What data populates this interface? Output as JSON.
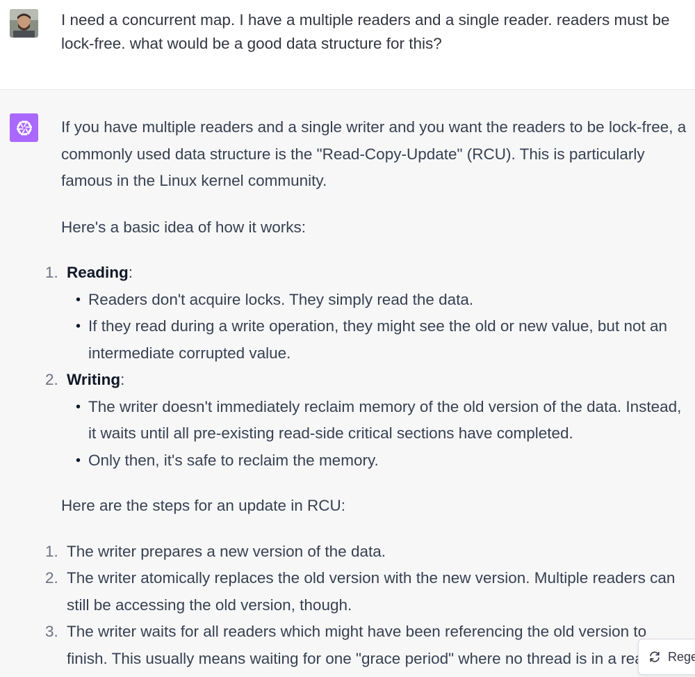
{
  "user_message": {
    "text": "I need a concurrent map. I have a multiple readers and a single reader. readers must be lock-free. what would be a good data structure for this?"
  },
  "assistant_message": {
    "intro": "If you have multiple readers and a single writer and you want the readers to be lock-free, a commonly used data structure is the \"Read-Copy-Update\" (RCU). This is particularly famous in the Linux kernel community.",
    "how_it_works": "Here's a basic idea of how it works:",
    "sections": [
      {
        "number": "1.",
        "title": "Reading",
        "suffix": ":",
        "bullets": [
          "Readers don't acquire locks. They simply read the data.",
          "If they read during a write operation, they might see the old or new value, but not an intermediate corrupted value."
        ]
      },
      {
        "number": "2.",
        "title": "Writing",
        "suffix": ":",
        "bullets": [
          "The writer doesn't immediately reclaim memory of the old version of the data. Instead, it waits until all pre-existing read-side critical sections have completed.",
          "Only then, it's safe to reclaim the memory."
        ]
      }
    ],
    "steps_heading": "Here are the steps for an update in RCU:",
    "steps": [
      {
        "number": "1.",
        "text": "The writer prepares a new version of the data."
      },
      {
        "number": "2.",
        "text": "The writer atomically replaces the old version with the new version. Multiple readers can still be accessing the old version, though."
      },
      {
        "number": "3.",
        "text": "The writer waits for all readers which might have been referencing the old version to finish. This usually means waiting for one \"grace period\" where no thread is in a read-side critical section."
      }
    ]
  },
  "regenerate_button": {
    "label": "Regenerate"
  },
  "colors": {
    "assistant_bg": "#f7f7f8",
    "gpt_avatar_bg": "#ab68ff",
    "text": "#374151"
  }
}
